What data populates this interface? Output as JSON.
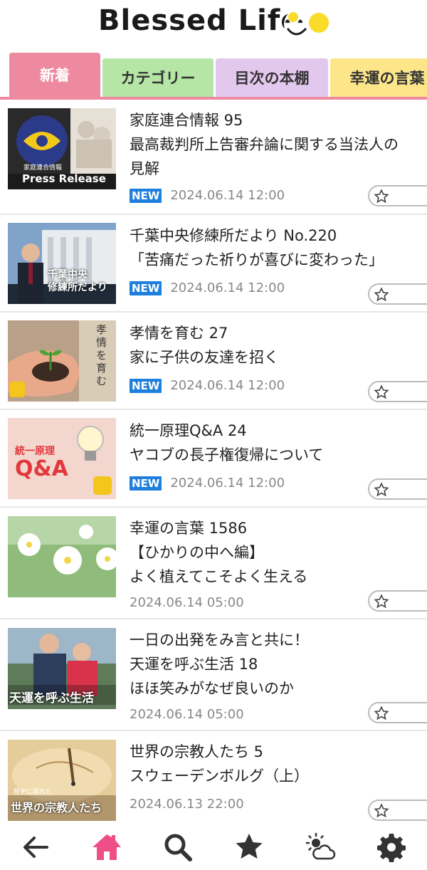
{
  "app": {
    "logo_text": "Blessed Life"
  },
  "tabs": [
    {
      "label": "新着",
      "color": "#ee8aa0",
      "active": true
    },
    {
      "label": "カテゴリー",
      "color": "#b5e6a6",
      "active": false
    },
    {
      "label": "目次の本棚",
      "color": "#e3c8ee",
      "active": false
    },
    {
      "label": "幸運の言葉",
      "color": "#fde58a",
      "active": false
    }
  ],
  "items": [
    {
      "title_lines": [
        "家庭連合情報 95",
        "最高裁判所上告審弁論に関する当法人の",
        "見解"
      ],
      "new": true,
      "new_label": "NEW",
      "date": "2024.06.14 12:00",
      "thumb": {
        "caption": "Press Release",
        "subcaption": "家庭連合情報"
      }
    },
    {
      "title_lines": [
        "千葉中央修練所だより No.220",
        "「苦痛だった祈りが喜びに変わった」"
      ],
      "new": true,
      "new_label": "NEW",
      "date": "2024.06.14 12:00",
      "thumb": {
        "caption": "千葉中央\n修練所だより"
      }
    },
    {
      "title_lines": [
        "孝情を育む 27",
        "家に子供の友達を招く"
      ],
      "new": true,
      "new_label": "NEW",
      "date": "2024.06.14 12:00",
      "thumb": {
        "caption": "孝情を育む"
      }
    },
    {
      "title_lines": [
        "統一原理Q&A 24",
        "ヤコブの長子権復帰について"
      ],
      "new": true,
      "new_label": "NEW",
      "date": "2024.06.14 12:00",
      "thumb": {
        "caption": "統一原理",
        "subcaption": "Q&A"
      }
    },
    {
      "title_lines": [
        "幸運の言葉 1586",
        "【ひかりの中へ編】",
        "よく植えてこそよく生える"
      ],
      "new": false,
      "date": "2024.06.14 05:00",
      "thumb": {}
    },
    {
      "title_lines": [
        "一日の出発をみ言と共に！",
        "天運を呼ぶ生活 18",
        "ほほ笑みがなぜ良いのか"
      ],
      "new": false,
      "date": "2024.06.14 05:00",
      "thumb": {
        "caption": "天運を呼ぶ生活"
      }
    },
    {
      "title_lines": [
        "世界の宗教人たち 5",
        "スウェーデンボルグ（上）"
      ],
      "new": false,
      "date": "2024.06.13 22:00",
      "thumb": {
        "caption": "世界の宗教人たち",
        "subcaption": "歴史に現れた"
      }
    }
  ],
  "bottom_nav": [
    {
      "name": "back-arrow-icon"
    },
    {
      "name": "home-icon",
      "active": true,
      "color": "#ee4f86"
    },
    {
      "name": "search-icon"
    },
    {
      "name": "star-icon"
    },
    {
      "name": "weather-icon"
    },
    {
      "name": "gear-icon"
    }
  ]
}
